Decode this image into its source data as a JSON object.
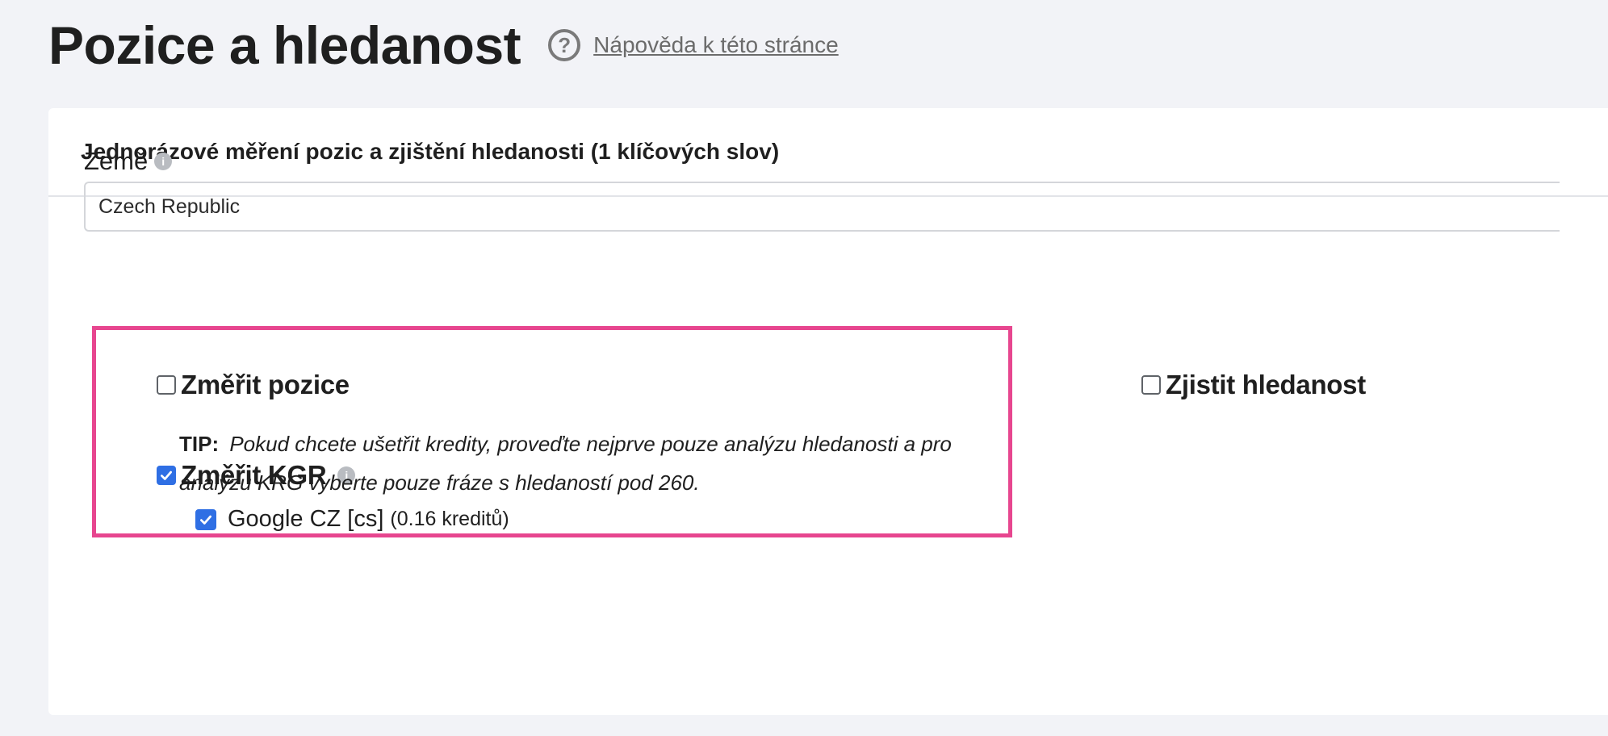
{
  "header": {
    "title": "Pozice a hledanost",
    "help_link": "Nápověda k této stránce"
  },
  "card": {
    "title": "Jednorázové měření pozic a zjištění hledanosti (1 klíčových slov)",
    "country": {
      "label": "Země",
      "value": "Czech Republic"
    },
    "measure_positions": {
      "label": "Změřit pozice",
      "checked": false
    },
    "search_volume": {
      "label": "Zjistit hledanost",
      "checked": false
    },
    "kgr": {
      "label": "Změřit KGR",
      "checked": true,
      "engine": {
        "label": "Google CZ [cs]",
        "credits": "(0.16 kreditů)",
        "checked": true
      },
      "tip_label": "TIP:",
      "tip_text": "Pokud chcete ušetřit kredity, proveďte nejprve pouze analýzu hledanosti a pro analýzu KRG vyberte pouze fráze s hledaností pod 260."
    }
  },
  "colors": {
    "accent": "#2f6fe4",
    "highlight": "#e7468f",
    "background": "#f2f3f7"
  }
}
